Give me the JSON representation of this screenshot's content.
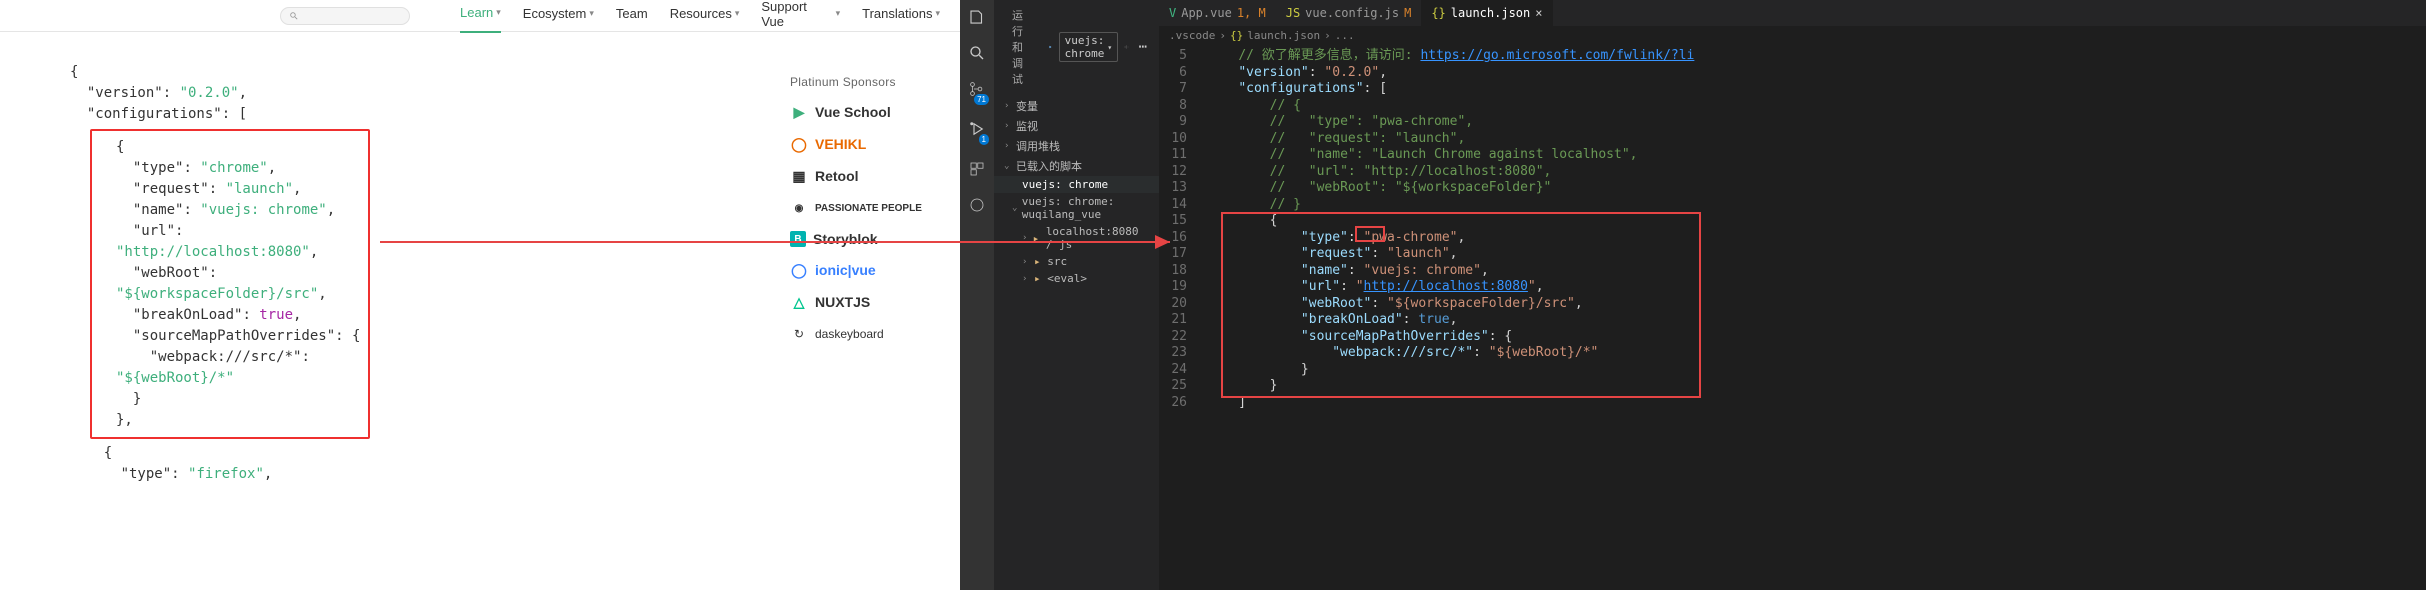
{
  "nav": {
    "learn": "Learn",
    "ecosystem": "Ecosystem",
    "team": "Team",
    "resources": "Resources",
    "support": "Support Vue",
    "translations": "Translations"
  },
  "left_code": {
    "l1": "{",
    "l2": "\"version\": \"0.2.0\",",
    "l3": "\"configurations\": [",
    "box_open": "{",
    "b1k": "\"type\"",
    "b1v": "\"chrome\"",
    "b2k": "\"request\"",
    "b2v": "\"launch\"",
    "b3k": "\"name\"",
    "b3v": "\"vuejs: chrome\"",
    "b4k": "\"url\"",
    "b4v": "\"http://localhost:8080\"",
    "b5k": "\"webRoot\"",
    "b5v": "\"${workspaceFolder}/src\"",
    "b6k": "\"breakOnLoad\"",
    "b7k": "\"sourceMapPathOverrides\"",
    "b8k": "\"webpack:///src/*\"",
    "b8v": "\"${webRoot}/*\"",
    "box_close": "},",
    "l_after1": "{",
    "l_after2": "\"type\": \"firefox\",",
    "true": "true"
  },
  "sponsors": {
    "title": "Platinum Sponsors",
    "items": [
      "Vue School",
      "VEHIKL",
      "Retool",
      "PASSIONATE PEOPLE",
      "Storyblok",
      "ionic|vue",
      "NUXTJS",
      "daskeyboard"
    ]
  },
  "vs": {
    "title": "运行和调试",
    "config": "vuejs: chrome",
    "tree": {
      "i1": "变量",
      "i2": "监视",
      "i3": "调用堆栈",
      "i4": "已载入的脚本",
      "i4a": "vuejs: chrome",
      "i4b": "vuejs: chrome: wuqilang_vue",
      "i4c": "localhost:8080 / js",
      "i4d": "src",
      "i4e": "<eval>"
    },
    "tabs": {
      "t1": "App.vue",
      "t1m": "1, M",
      "t2": "vue.config.js",
      "t2m": "M",
      "t3": "launch.json"
    },
    "bread": {
      "b1": ".vscode",
      "b2": "launch.json",
      "b3": "..."
    },
    "badge": "71",
    "gutter_start": 5,
    "code": {
      "l5_com": "// 欲了解更多信息，请访问: ",
      "l5_url": "https://go.microsoft.com/fwlink/?li",
      "l6k": "\"version\"",
      "l6v": "\"0.2.0\"",
      "l7k": "\"configurations\"",
      "l8": "// {",
      "l9": "//   \"type\": \"pwa-chrome\",",
      "l10": "//   \"request\": \"launch\",",
      "l11": "//   \"name\": \"Launch Chrome against localhost\",",
      "l12": "//   \"url\": \"http://localhost:8080\",",
      "l13": "//   \"webRoot\": \"${workspaceFolder}\"",
      "l14": "// }",
      "l15": "{",
      "l16k": "\"type\"",
      "l16v": "pwa-chrome",
      "l17k": "\"request\"",
      "l17v": "\"launch\"",
      "l18k": "\"name\"",
      "l18v": "\"vuejs: chrome\"",
      "l19k": "\"url\"",
      "l19v": "http://localhost:8080",
      "l20k": "\"webRoot\"",
      "l20v": "\"${workspaceFolder}/src\"",
      "l21k": "\"breakOnLoad\"",
      "l22k": "\"sourceMapPathOverrides\"",
      "l23k": "\"webpack:///src/*\"",
      "l23v": "\"${webRoot}/*\"",
      "l24": "}",
      "l25": "}",
      "l26": "]",
      "true": "true"
    }
  }
}
